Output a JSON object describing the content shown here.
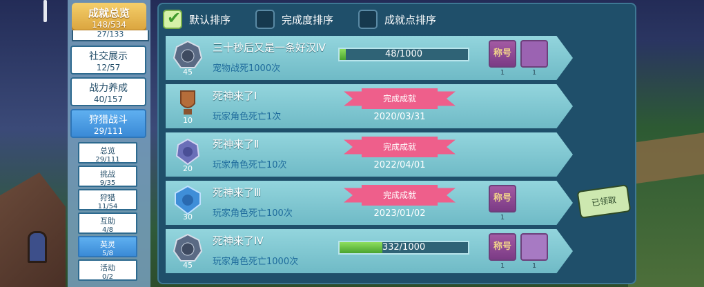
{
  "nav": {
    "summary": {
      "label": "成就总览",
      "count": "148/534"
    },
    "cut_item": "27/133",
    "categories": [
      {
        "label": "社交展示",
        "count": "12/57"
      },
      {
        "label": "战力养成",
        "count": "40/157"
      },
      {
        "label": "狩猎战斗",
        "count": "29/111"
      }
    ],
    "subs": [
      {
        "label": "总览",
        "count": "29/111"
      },
      {
        "label": "挑战",
        "count": "9/35"
      },
      {
        "label": "狩猎",
        "count": "11/54"
      },
      {
        "label": "互助",
        "count": "4/8"
      },
      {
        "label": "英灵",
        "count": "5/8"
      },
      {
        "label": "活动",
        "count": "0/2"
      }
    ]
  },
  "sort": {
    "default": "默认排序",
    "completion": "完成度排序",
    "points": "成就点排序"
  },
  "rows": [
    {
      "badge_level": "45",
      "name": "三十秒后又是一条好汉Ⅳ",
      "desc": "宠物战死1000次",
      "progress_text": "48/1000",
      "progress": 0.048,
      "rewards": [
        {
          "type": "title",
          "label": "称号",
          "count": "1"
        },
        {
          "type": "frame",
          "count": "1"
        }
      ]
    },
    {
      "badge_level": "10",
      "name": "死神来了Ⅰ",
      "desc": "玩家角色死亡1次",
      "ribbon": "完成成就",
      "date": "2020/03/31"
    },
    {
      "badge_level": "20",
      "name": "死神来了Ⅱ",
      "desc": "玩家角色死亡10次",
      "ribbon": "完成成就",
      "date": "2022/04/01"
    },
    {
      "badge_level": "30",
      "name": "死神来了Ⅲ",
      "desc": "玩家角色死亡100次",
      "ribbon": "完成成就",
      "date": "2023/01/02",
      "rewards": [
        {
          "type": "title",
          "label": "称号",
          "count": "1"
        }
      ],
      "claimed": "已领取"
    },
    {
      "badge_level": "45",
      "name": "死神来了Ⅳ",
      "desc": "玩家角色死亡1000次",
      "progress_text": "332/1000",
      "progress": 0.332,
      "rewards": [
        {
          "type": "title",
          "label": "称号",
          "count": "1"
        },
        {
          "type": "pet",
          "count": "1"
        }
      ]
    }
  ]
}
